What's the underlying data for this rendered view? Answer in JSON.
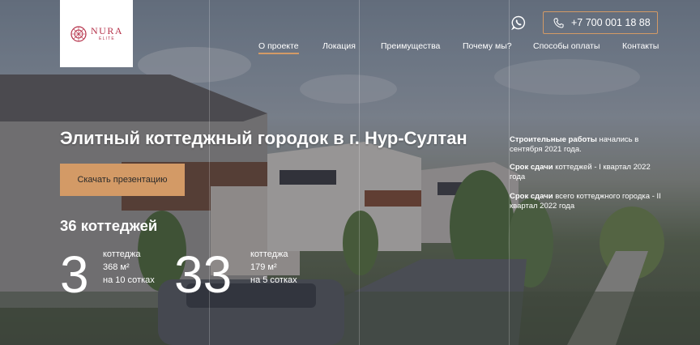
{
  "brand": {
    "name": "NURA",
    "sub": "ELITE",
    "accent": "#d39a66",
    "brand_color": "#b5324a"
  },
  "header": {
    "phone": "+7 700 001 18 88",
    "whatsapp_icon": "whatsapp-icon",
    "phone_icon": "phone-icon"
  },
  "nav": [
    {
      "label": "О проекте",
      "active": true
    },
    {
      "label": "Локация"
    },
    {
      "label": "Преимущества"
    },
    {
      "label": "Почему мы?"
    },
    {
      "label": "Способы оплаты"
    },
    {
      "label": "Контакты"
    }
  ],
  "hero": {
    "title": "Элитный коттеджный городок в г. Нур-Султан",
    "cta": "Скачать презентацию",
    "count_title": "36 коттеджей",
    "stats": [
      {
        "number": "3",
        "lines": [
          "коттеджа",
          "368 м²",
          "на 10 сотках"
        ]
      },
      {
        "number": "33",
        "lines": [
          "коттеджа",
          "179 м²",
          "на 5 сотках"
        ]
      }
    ]
  },
  "side_info": [
    {
      "bold": "Строительные работы",
      "text": " начались в сентября 2021 года."
    },
    {
      "bold": "Срок сдачи",
      "text": " коттеджей - I квартал 2022 года"
    },
    {
      "bold": "Срок сдачи",
      "text": " всего коттеджного городка - II квартал 2022 года"
    }
  ]
}
